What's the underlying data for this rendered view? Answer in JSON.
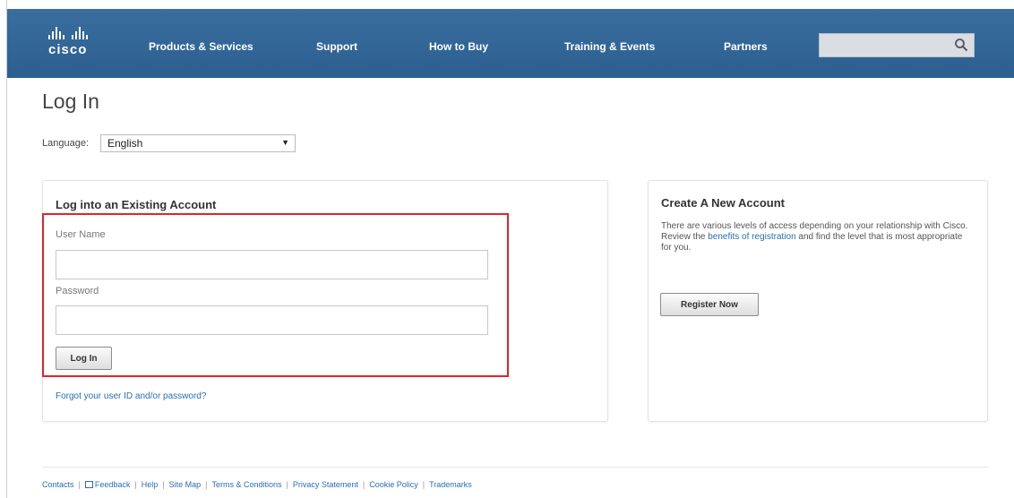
{
  "brand": {
    "logo_text": "cisco"
  },
  "nav": {
    "items": [
      {
        "label": "Products & Services"
      },
      {
        "label": "Support"
      },
      {
        "label": "How to Buy"
      },
      {
        "label": "Training & Events"
      },
      {
        "label": "Partners"
      }
    ]
  },
  "search": {
    "value": "",
    "icon": "magnifier-icon"
  },
  "page": {
    "title": "Log In"
  },
  "language": {
    "label": "Language:",
    "selected": "English"
  },
  "login": {
    "heading": "Log into an Existing Account",
    "username_label": "User Name",
    "username_value": "",
    "password_label": "Password",
    "password_value": "",
    "button_label": "Log In",
    "forgot_link": "Forgot your user ID and/or password?",
    "highlight_color": "#e1232b"
  },
  "create": {
    "heading": "Create A New Account",
    "text_before": "There are various levels of access depending on your relationship with Cisco. Review the ",
    "link_text": "benefits of registration",
    "text_after": " and find the level that is most appropriate for you.",
    "button_label": "Register Now"
  },
  "footer": {
    "links": [
      {
        "label": "Contacts"
      },
      {
        "label": "Feedback"
      },
      {
        "label": "Help"
      },
      {
        "label": "Site Map"
      },
      {
        "label": "Terms & Conditions"
      },
      {
        "label": "Privacy Statement"
      },
      {
        "label": "Cookie Policy"
      },
      {
        "label": "Trademarks"
      }
    ]
  },
  "colors": {
    "header_blue": "#2c5f90",
    "link_blue": "#2a6eb3"
  }
}
